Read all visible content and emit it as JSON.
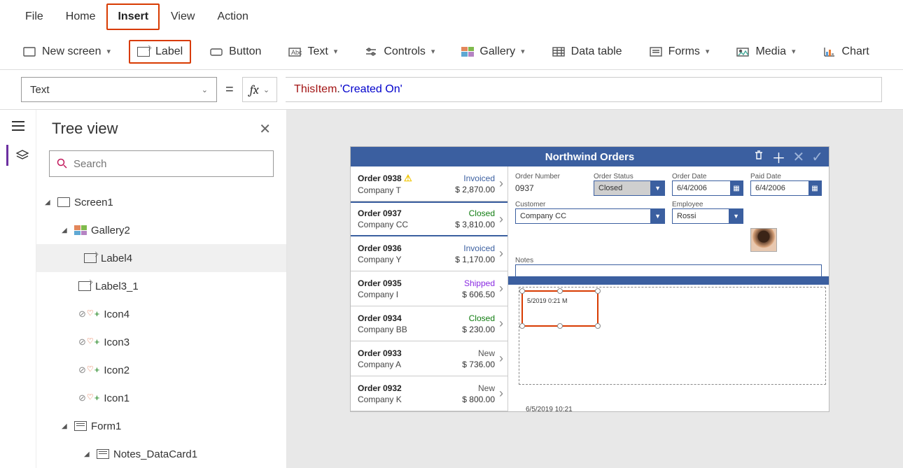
{
  "menu": {
    "file": "File",
    "home": "Home",
    "insert": "Insert",
    "view": "View",
    "action": "Action"
  },
  "ribbon": {
    "newscreen": "New screen",
    "label": "Label",
    "button": "Button",
    "text": "Text",
    "controls": "Controls",
    "gallery": "Gallery",
    "datatable": "Data table",
    "forms": "Forms",
    "media": "Media",
    "chart": "Chart"
  },
  "formula": {
    "prop": "Text",
    "fx_this": "ThisItem",
    "fx_dot": ".",
    "fx_prop": "'Created On'"
  },
  "tree": {
    "title": "Tree view",
    "search_ph": "Search",
    "screen1": "Screen1",
    "gallery2": "Gallery2",
    "label4": "Label4",
    "label3_1": "Label3_1",
    "icon4": "Icon4",
    "icon3": "Icon3",
    "icon2": "Icon2",
    "icon1": "Icon1",
    "form1": "Form1",
    "notesdc": "Notes_DataCard1"
  },
  "app": {
    "title": "Northwind Orders",
    "orders": [
      {
        "name": "Order 0938",
        "company": "Company T",
        "status": "Invoiced",
        "amount": "$ 2,870.00",
        "warn": true,
        "cls": "st-invoiced"
      },
      {
        "name": "Order 0937",
        "company": "Company CC",
        "status": "Closed",
        "amount": "$ 3,810.00",
        "sel": true,
        "cls": "st-closed"
      },
      {
        "name": "Order 0936",
        "company": "Company Y",
        "status": "Invoiced",
        "amount": "$ 1,170.00",
        "cls": "st-invoiced"
      },
      {
        "name": "Order 0935",
        "company": "Company I",
        "status": "Shipped",
        "amount": "$ 606.50",
        "cls": "st-shipped"
      },
      {
        "name": "Order 0934",
        "company": "Company BB",
        "status": "Closed",
        "amount": "$ 230.00",
        "cls": "st-closed"
      },
      {
        "name": "Order 0933",
        "company": "Company A",
        "status": "New",
        "amount": "$ 736.00",
        "cls": "st-new"
      },
      {
        "name": "Order 0932",
        "company": "Company K",
        "status": "New",
        "amount": "$ 800.00",
        "cls": "st-new"
      }
    ],
    "labels": {
      "ordernum": "Order Number",
      "orderstatus": "Order Status",
      "orderdate": "Order Date",
      "paiddate": "Paid Date",
      "customer": "Customer",
      "employee": "Employee",
      "notes": "Notes"
    },
    "vals": {
      "ordernum": "0937",
      "orderstatus": "Closed",
      "orderdate": "6/4/2006",
      "paiddate": "6/4/2006",
      "customer": "Company CC",
      "employee": "Rossi"
    },
    "sel_label_text": "5/2019 0:21 M",
    "ts_label": "6/5/2019 10:21"
  }
}
